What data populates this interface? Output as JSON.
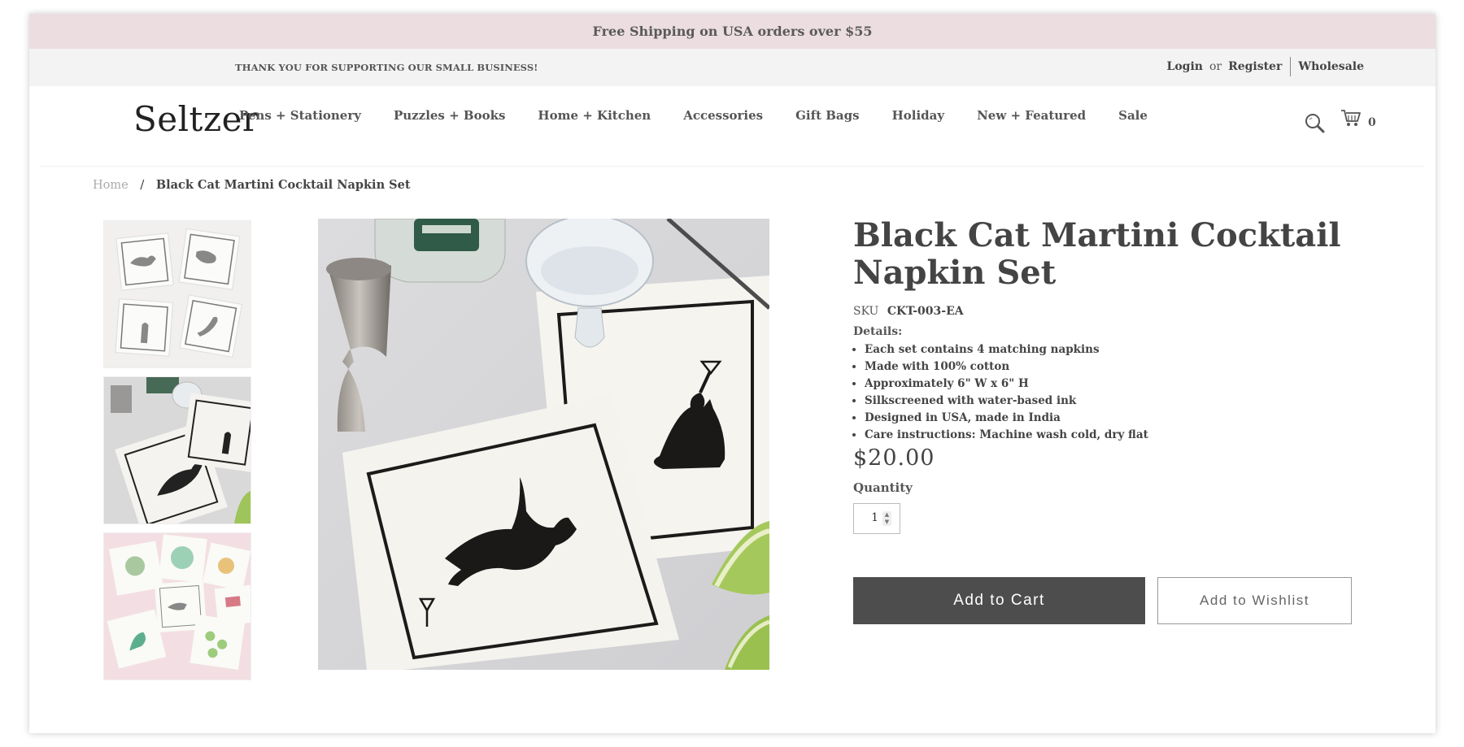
{
  "promo": {
    "text": "Free Shipping on USA orders over $55"
  },
  "utility": {
    "thanks": "THANK YOU FOR SUPPORTING OUR SMALL BUSINESS!",
    "login": "Login",
    "or": "or",
    "register": "Register",
    "wholesale": "Wholesale"
  },
  "header": {
    "logo": "Seltzer",
    "nav": [
      "Pens + Stationery",
      "Puzzles + Books",
      "Home + Kitchen",
      "Accessories",
      "Gift Bags",
      "Holiday",
      "New + Featured",
      "Sale"
    ],
    "cart_count": "0",
    "icons": {
      "search": "search-icon",
      "cart": "cart-icon"
    }
  },
  "breadcrumb": {
    "home": "Home",
    "separator": "/",
    "current": "Black Cat Martini Cocktail Napkin Set"
  },
  "product": {
    "title": "Black Cat Martini Cocktail Napkin Set",
    "sku_label": "SKU",
    "sku": "CKT-003-EA",
    "details_label": "Details:",
    "details": [
      "Each set contains 4 matching napkins",
      "Made with 100% cotton",
      "Approximately 6\" W x 6\" H",
      "Silkscreened with water-based ink",
      "Designed in USA, made in India",
      "Care instructions: Machine wash cold, dry flat"
    ],
    "price": "$20.00",
    "quantity_label": "Quantity",
    "quantity": "1",
    "add_to_cart": "Add to Cart",
    "add_to_wishlist": "Add to Wishlist"
  },
  "colors": {
    "promo_bg": "#ecdde0",
    "utility_bg": "#f3f3f3",
    "cart_button": "#4d4d4d"
  }
}
